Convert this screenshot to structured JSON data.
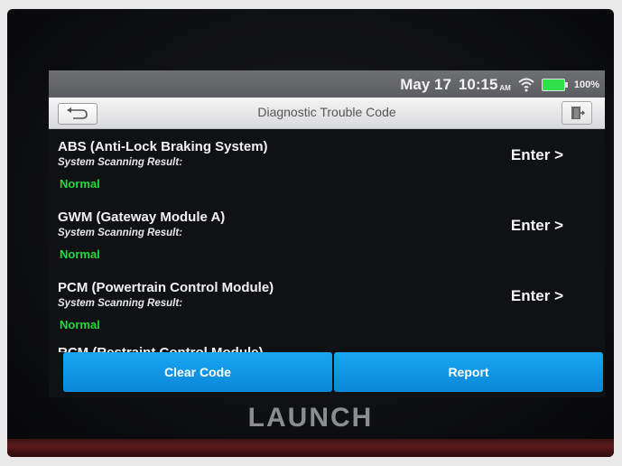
{
  "status": {
    "date": "May 17",
    "time": "10:15",
    "ampm": "AM",
    "battery": "100%"
  },
  "header": {
    "title": "Diagnostic Trouble Code"
  },
  "modules": [
    {
      "name": "ABS (Anti-Lock Braking System)",
      "subtitle": "System Scanning Result:",
      "status": "Normal",
      "action": "Enter >"
    },
    {
      "name": "GWM (Gateway Module A)",
      "subtitle": "System Scanning Result:",
      "status": "Normal",
      "action": "Enter >"
    },
    {
      "name": "PCM (Powertrain Control Module)",
      "subtitle": "System Scanning Result:",
      "status": "Normal",
      "action": "Enter >"
    },
    {
      "name": "RCM (Restraint Control Module)"
    }
  ],
  "footer": {
    "clear_label": "Clear Code",
    "report_label": "Report"
  },
  "brand": "LAUNCH",
  "colors": {
    "accent": "#0f97e6",
    "normal": "#1fdc3a"
  }
}
